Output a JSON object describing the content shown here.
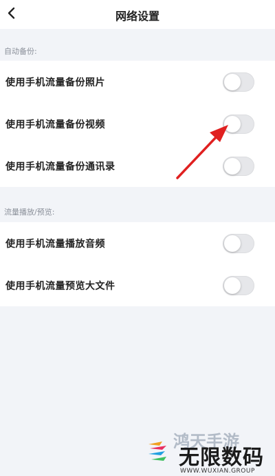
{
  "header": {
    "title": "网络设置",
    "back_icon": "chevron-left-icon"
  },
  "sections": [
    {
      "title": "自动备份:",
      "items": [
        {
          "label": "使用手机流量备份照片",
          "enabled": false
        },
        {
          "label": "使用手机流量备份视频",
          "enabled": false
        },
        {
          "label": "使用手机流量备份通讯录",
          "enabled": false
        }
      ]
    },
    {
      "title": "流量播放/预览:",
      "items": [
        {
          "label": "使用手机流量播放音频",
          "enabled": false
        },
        {
          "label": "使用手机流量预览大文件",
          "enabled": false
        }
      ]
    }
  ],
  "annotation": {
    "arrow_color": "#e02020"
  },
  "watermark": {
    "top_text": "鸿天手游",
    "main_text": "无限数码",
    "url_text": "WWW.WUXIAN.GROUP"
  }
}
